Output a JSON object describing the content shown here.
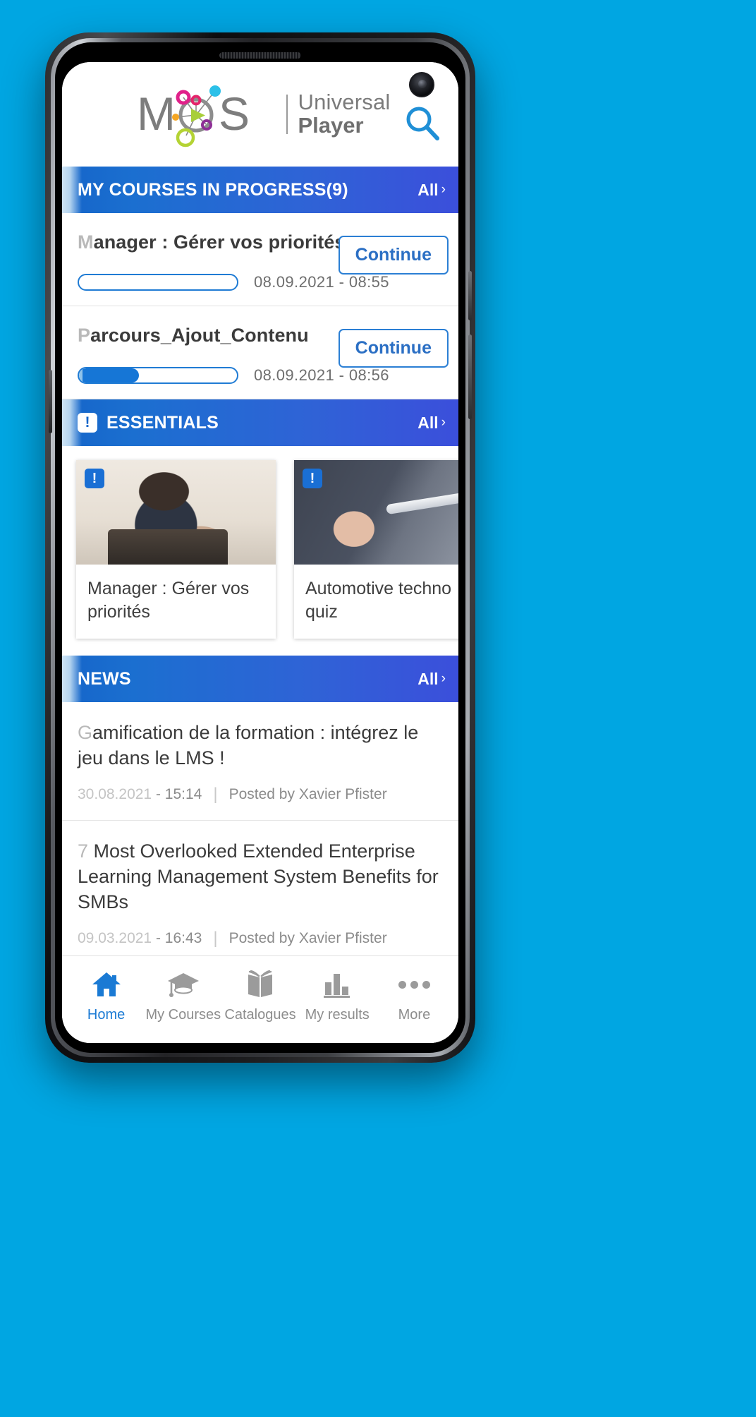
{
  "app": {
    "logo_primary": "MoS",
    "logo_line1": "Universal",
    "logo_line2": "Player",
    "search_icon": "search-icon",
    "camera_icon": "front-camera"
  },
  "sections": {
    "courses": {
      "title": "MY COURSES IN PROGRESS(9)",
      "all_label": "All",
      "chevron": "›",
      "items": [
        {
          "title_first": "M",
          "title_rest": "anager : Gérer vos priorités",
          "title_full": "Manager : Gérer vos priorités",
          "progress": 0,
          "date": "08.09.2021",
          "separator": "-",
          "time": "08:55",
          "action_label": "Continue"
        },
        {
          "title_first": "P",
          "title_rest": "arcours_Ajout_Contenu",
          "title_full": "Parcours_Ajout_Contenu",
          "progress": 38,
          "date": "08.09.2021",
          "separator": "-",
          "time": "08:56",
          "action_label": "Continue"
        }
      ]
    },
    "essentials": {
      "title": "ESSENTIALS",
      "badge": "!",
      "all_label": "All",
      "chevron": "›",
      "cards": [
        {
          "title": "Manager : Gérer vos priorités",
          "badge": "!",
          "photo": "man-with-glasses-at-laptop"
        },
        {
          "title": "Automotive techno quiz",
          "badge": "!",
          "photo": "hands-holding-white-tube"
        }
      ]
    },
    "news": {
      "title": "NEWS",
      "all_label": "All",
      "chevron": "›",
      "items": [
        {
          "title_first": "G",
          "title_rest": "amification de la formation : intégrez le jeu dans le LMS !",
          "title_full": "Gamification de la formation : intégrez le jeu dans le LMS !",
          "date": "30.08.2021",
          "separator": "-",
          "time": "15:14",
          "divider": "|",
          "author": "Posted by Xavier Pfister"
        },
        {
          "title_first": "7",
          "title_rest": " Most Overlooked Extended Enterprise Learning Management System Benefits for SMBs",
          "title_full": "7 Most Overlooked Extended Enterprise Learning Management System Benefits for SMBs",
          "date": "09.03.2021",
          "separator": "-",
          "time": "16:43",
          "divider": "|",
          "author": "Posted by Xavier Pfister"
        }
      ]
    }
  },
  "bottom_nav": {
    "items": [
      {
        "label": "Home",
        "icon": "home-icon",
        "active": true
      },
      {
        "label": "My Courses",
        "icon": "graduation-cap-icon",
        "active": false
      },
      {
        "label": "Catalogues",
        "icon": "open-book-icon",
        "active": false
      },
      {
        "label": "My results",
        "icon": "bar-chart-icon",
        "active": false
      },
      {
        "label": "More",
        "icon": "ellipsis-icon",
        "active": false
      }
    ]
  },
  "colors": {
    "background": "#00a6e2",
    "accent_blue": "#1a7ad4",
    "bar_gradient_start": "#1565c9",
    "bar_gradient_end": "#3b4fdb"
  }
}
